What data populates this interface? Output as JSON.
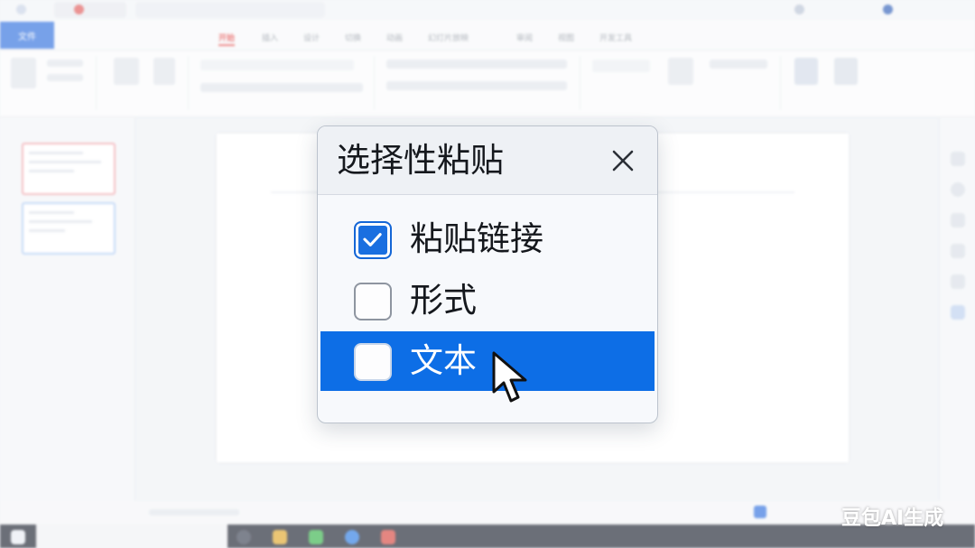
{
  "app": {
    "file_menu_label": "文件",
    "menu_items": [
      "开始",
      "插入",
      "设计",
      "切换",
      "动画",
      "幻灯片放映",
      "审阅",
      "视图",
      "开发工具"
    ]
  },
  "dialog": {
    "title": "选择性粘贴",
    "close_icon": "close-icon",
    "options": [
      {
        "label": "粘贴链接",
        "checked": true,
        "highlighted": false
      },
      {
        "label": "形式",
        "checked": false,
        "highlighted": false
      },
      {
        "label": "文本",
        "checked": false,
        "highlighted": true
      }
    ]
  },
  "watermark": "豆包AI生成",
  "colors": {
    "accent": "#0d6ee6",
    "checkbox_checked": "#1a6fe0",
    "file_button": "#2f6fde",
    "taskbar": "#1d2230"
  }
}
